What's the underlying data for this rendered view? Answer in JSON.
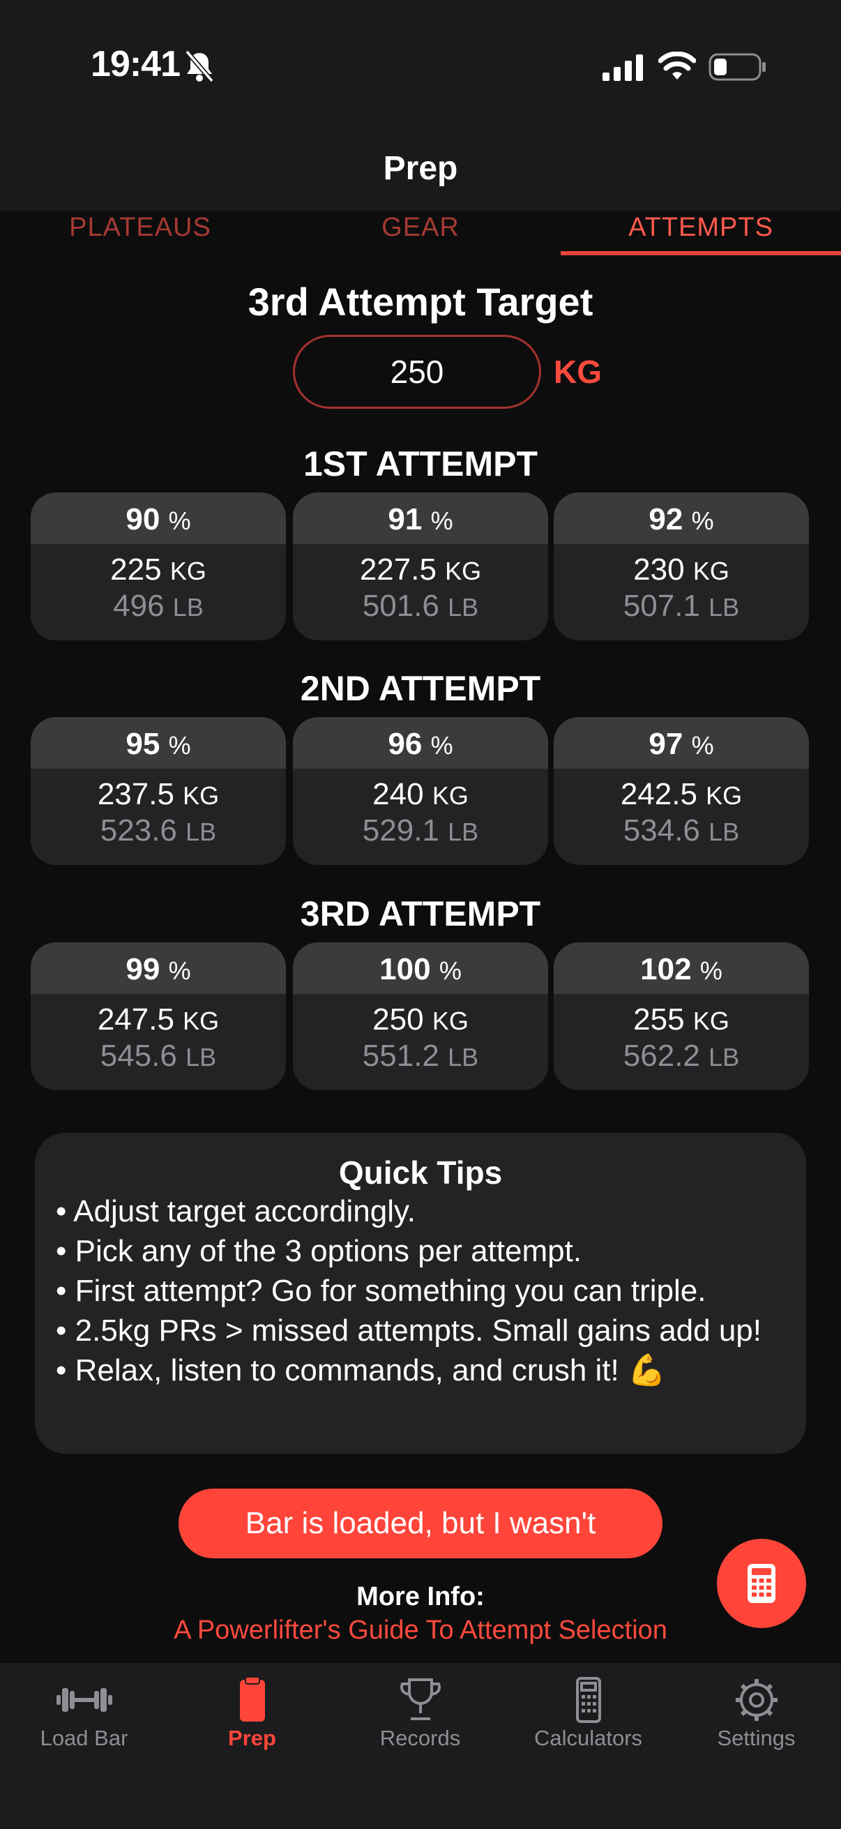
{
  "status_bar": {
    "time": "19:41"
  },
  "header": {
    "title": "Prep"
  },
  "tabs": [
    {
      "label": "PLATEAUS",
      "active": false
    },
    {
      "label": "GEAR",
      "active": false
    },
    {
      "label": "ATTEMPTS",
      "active": true
    }
  ],
  "target": {
    "heading": "3rd Attempt Target",
    "value": "250",
    "unit": "KG"
  },
  "attempts": [
    {
      "title": "1ST ATTEMPT",
      "options": [
        {
          "pct": "90",
          "kg": "225",
          "lb": "496"
        },
        {
          "pct": "91",
          "kg": "227.5",
          "lb": "501.6"
        },
        {
          "pct": "92",
          "kg": "230",
          "lb": "507.1"
        }
      ]
    },
    {
      "title": "2ND ATTEMPT",
      "options": [
        {
          "pct": "95",
          "kg": "237.5",
          "lb": "523.6"
        },
        {
          "pct": "96",
          "kg": "240",
          "lb": "529.1"
        },
        {
          "pct": "97",
          "kg": "242.5",
          "lb": "534.6"
        }
      ]
    },
    {
      "title": "3RD ATTEMPT",
      "options": [
        {
          "pct": "99",
          "kg": "247.5",
          "lb": "545.6"
        },
        {
          "pct": "100",
          "kg": "250",
          "lb": "551.2"
        },
        {
          "pct": "102",
          "kg": "255",
          "lb": "562.2"
        }
      ]
    }
  ],
  "units": {
    "pct": "%",
    "kg": "KG",
    "lb": "LB"
  },
  "tips": {
    "title": "Quick Tips",
    "items": [
      "• Adjust target accordingly.",
      "• Pick any of the 3 options per attempt.",
      "• First attempt? Go for something you can triple.",
      "• 2.5kg PRs > missed attempts. Small gains add up!",
      "• Relax, listen to commands, and crush it! 💪"
    ]
  },
  "actions": {
    "loaded_button": "Bar is loaded, but I wasn't"
  },
  "more_info": {
    "label": "More Info:",
    "link": "A Powerlifter's Guide To Attempt Selection"
  },
  "bottom_nav": [
    {
      "label": "Load Bar",
      "icon": "barbell-icon",
      "active": false
    },
    {
      "label": "Prep",
      "icon": "clipboard-icon",
      "active": true
    },
    {
      "label": "Records",
      "icon": "trophy-icon",
      "active": false
    },
    {
      "label": "Calculators",
      "icon": "calculator-icon",
      "active": false
    },
    {
      "label": "Settings",
      "icon": "gear-icon",
      "active": false
    }
  ],
  "colors": {
    "accent": "#ff453a",
    "background": "#0d0d0d",
    "card": "#232325"
  }
}
